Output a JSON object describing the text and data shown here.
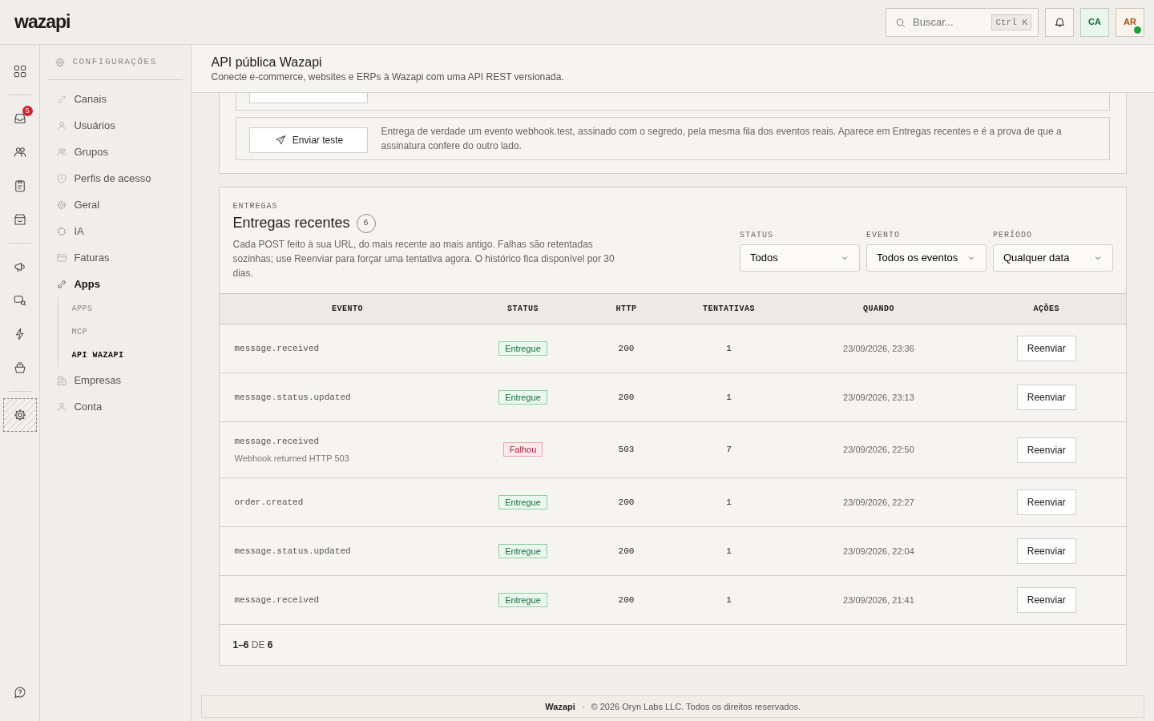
{
  "topbar": {
    "logo": "wazapi",
    "search": {
      "placeholder": "Buscar...",
      "shortcut": "Ctrl K"
    },
    "avatars": [
      {
        "initials": "CA",
        "online": false
      },
      {
        "initials": "AR",
        "online": true
      }
    ]
  },
  "rail": {
    "items": [
      {
        "selected": false
      },
      {
        "selected": false,
        "badge": "5"
      },
      {
        "selected": false
      },
      {
        "selected": false
      },
      {
        "selected": false
      },
      {
        "selected": false
      },
      {
        "selected": false
      },
      {
        "selected": false
      },
      {
        "selected": false
      },
      {
        "selected": true
      }
    ]
  },
  "sidebar": {
    "heading": "CONFIGURAÇÕES",
    "items": [
      {
        "label": "Canais",
        "selected": false
      },
      {
        "label": "Usuários",
        "selected": false
      },
      {
        "label": "Grupos",
        "selected": false
      },
      {
        "label": "Perfis de acesso",
        "selected": false
      },
      {
        "label": "Geral",
        "selected": false
      },
      {
        "label": "IA",
        "selected": false
      },
      {
        "label": "Faturas",
        "selected": false
      },
      {
        "label": "Apps",
        "selected": true,
        "children": [
          {
            "label": "APPS",
            "selected": false
          },
          {
            "label": "MCP",
            "selected": false
          },
          {
            "label": "API WAZAPI",
            "selected": true
          }
        ]
      },
      {
        "label": "Empresas",
        "selected": false
      },
      {
        "label": "Conta",
        "selected": false
      }
    ]
  },
  "page": {
    "title": "API pública Wazapi",
    "subtitle": "Conecte e-commerce, websites e ERPs à Wazapi com uma API REST versionada."
  },
  "test": {
    "button": "Enviar teste",
    "description": "Entrega de verdade um evento webhook.test, assinado com o segredo, pela mesma fila dos eventos reais. Aparece em Entregas recentes e é a prova de que a assinatura confere do outro lado."
  },
  "deliveries": {
    "eyebrow": "ENTREGAS",
    "title": "Entregas recentes",
    "count": "6",
    "description": "Cada POST feito à sua URL, do mais recente ao mais antigo. Falhas são retentadas sozinhas; use Reenviar para forçar uma tentativa agora. O histórico fica disponível por 30 dias.",
    "filters": [
      {
        "label": "STATUS",
        "value": "Todos"
      },
      {
        "label": "EVENTO",
        "value": "Todos os eventos"
      },
      {
        "label": "PERÍODO",
        "value": "Qualquer data"
      }
    ],
    "columns": [
      "EVENTO",
      "STATUS",
      "HTTP",
      "TENTATIVAS",
      "QUANDO",
      "AÇÕES"
    ],
    "rows": [
      {
        "event": "message.received",
        "status": {
          "label": "Entregue",
          "kind": "ok"
        },
        "http": "200",
        "attempts": "1",
        "when": "23/09/2026, 23:36",
        "action": "Reenviar"
      },
      {
        "event": "message.status.updated",
        "status": {
          "label": "Entregue",
          "kind": "ok"
        },
        "http": "200",
        "attempts": "1",
        "when": "23/09/2026, 23:13",
        "action": "Reenviar"
      },
      {
        "event": "message.received",
        "error": "Webhook returned HTTP 503",
        "status": {
          "label": "Falhou",
          "kind": "failed"
        },
        "http": "503",
        "attempts": "7",
        "when": "23/09/2026, 22:50",
        "action": "Reenviar"
      },
      {
        "event": "order.created",
        "status": {
          "label": "Entregue",
          "kind": "ok"
        },
        "http": "200",
        "attempts": "1",
        "when": "23/09/2026, 22:27",
        "action": "Reenviar"
      },
      {
        "event": "message.status.updated",
        "status": {
          "label": "Entregue",
          "kind": "ok"
        },
        "http": "200",
        "attempts": "1",
        "when": "23/09/2026, 22:04",
        "action": "Reenviar"
      },
      {
        "event": "message.received",
        "status": {
          "label": "Entregue",
          "kind": "ok"
        },
        "http": "200",
        "attempts": "1",
        "when": "23/09/2026, 21:41",
        "action": "Reenviar"
      }
    ],
    "pagination": {
      "range": "1–6",
      "of": "DE",
      "total": "6"
    }
  },
  "footer": {
    "brand": "Wazapi",
    "sep": "·",
    "copyright": "© 2026 Oryn Labs LLC. Todos os direitos reservados."
  }
}
